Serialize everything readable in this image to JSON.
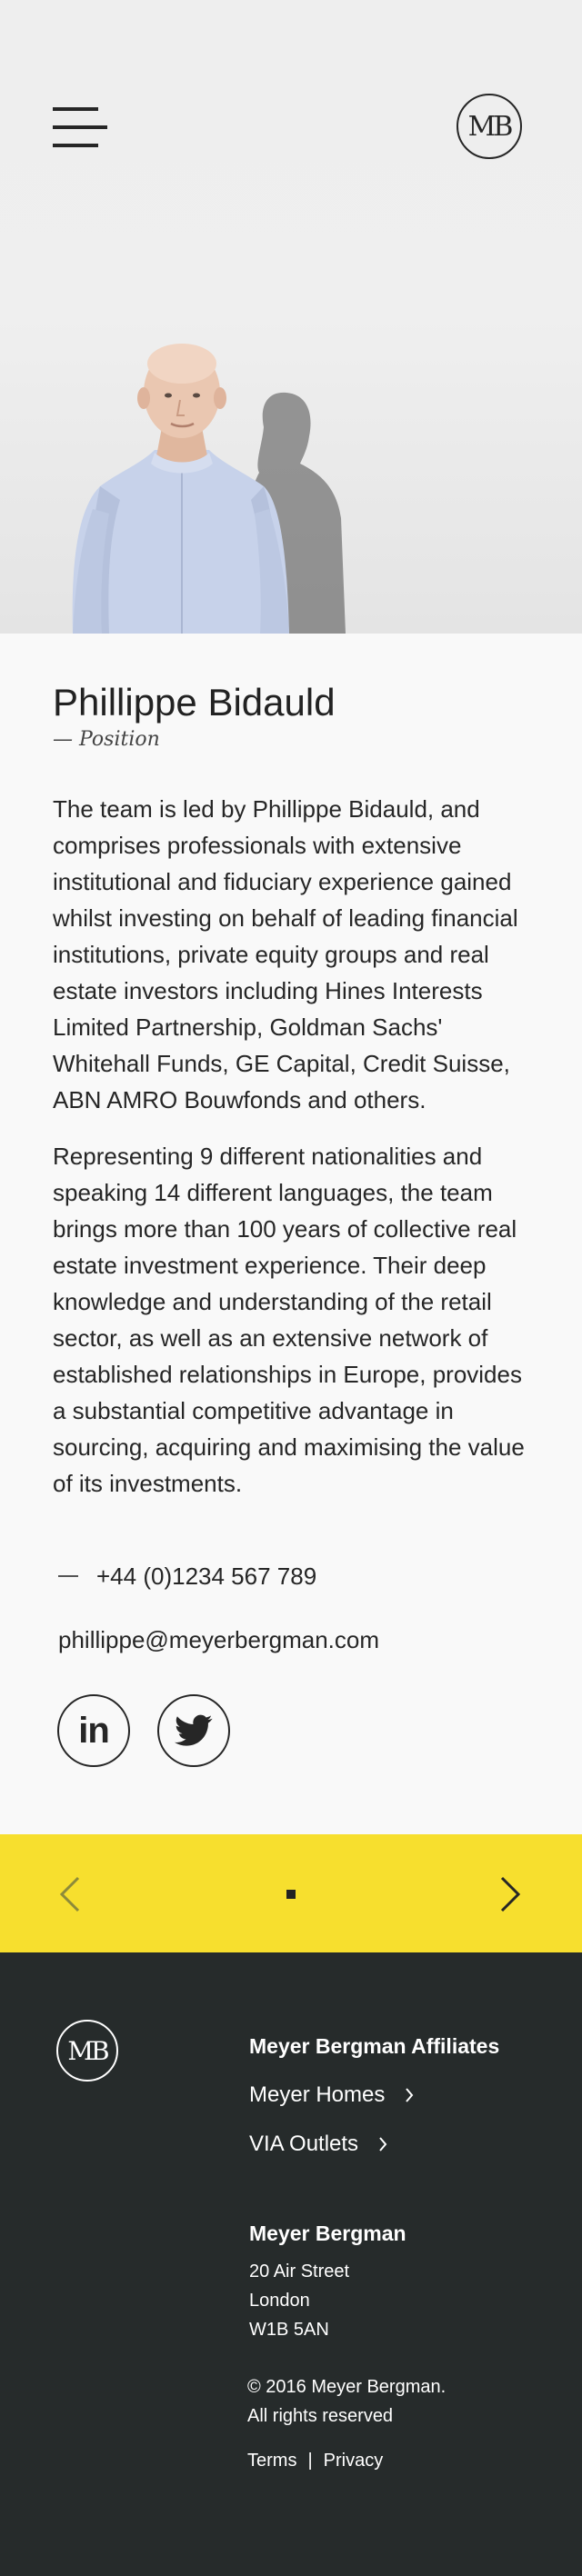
{
  "header": {
    "logo_text": "MB"
  },
  "profile": {
    "name": "Phillippe Bidauld",
    "position": "— Position",
    "paragraphs": [
      "The team is led by Phillippe Bidauld, and comprises professionals with extensive institutional and fiduciary experience gained whilst investing on behalf of leading financial institutions, private equity groups and real estate investors including Hines Interests Limited Partnership, Goldman Sachs' Whitehall Funds, GE Capital, Credit Suisse, ABN AMRO Bouwfonds and others.",
      "Representing 9 different nationalities and speaking 14 different languages, the team brings more than 100 years of collective real estate investment experience. Their deep knowledge and understanding of the retail sector, as well as an extensive network of established relationships in Europe, provides a substantial competitive advantage in sourcing, acquiring and maximising the value of its investments."
    ],
    "phone": "+44 (0)1234 567 789",
    "email": "phillippe@meyerbergman.com",
    "socials": [
      {
        "icon": "linkedin-icon",
        "label": "in"
      },
      {
        "icon": "twitter-icon"
      }
    ]
  },
  "pager": {
    "prev_icon": "chevron-left-icon",
    "next_icon": "chevron-right-icon"
  },
  "footer": {
    "logo_text": "MB",
    "affiliates_heading": "Meyer Bergman Affiliates",
    "affiliates": [
      "Meyer Homes",
      "VIA Outlets"
    ],
    "company_heading": "Meyer Bergman",
    "address": [
      "20 Air Street",
      "London",
      "W1B 5AN"
    ],
    "copyright": [
      "© 2016 Meyer Bergman.",
      "All rights reserved"
    ],
    "legal": {
      "terms": "Terms",
      "separator": "|",
      "privacy": "Privacy"
    }
  },
  "colors": {
    "hero_bg": "#efefef",
    "body_bg": "#f9f9f9",
    "accent_yellow": "#f7df2e",
    "footer_bg": "#262b2b"
  }
}
